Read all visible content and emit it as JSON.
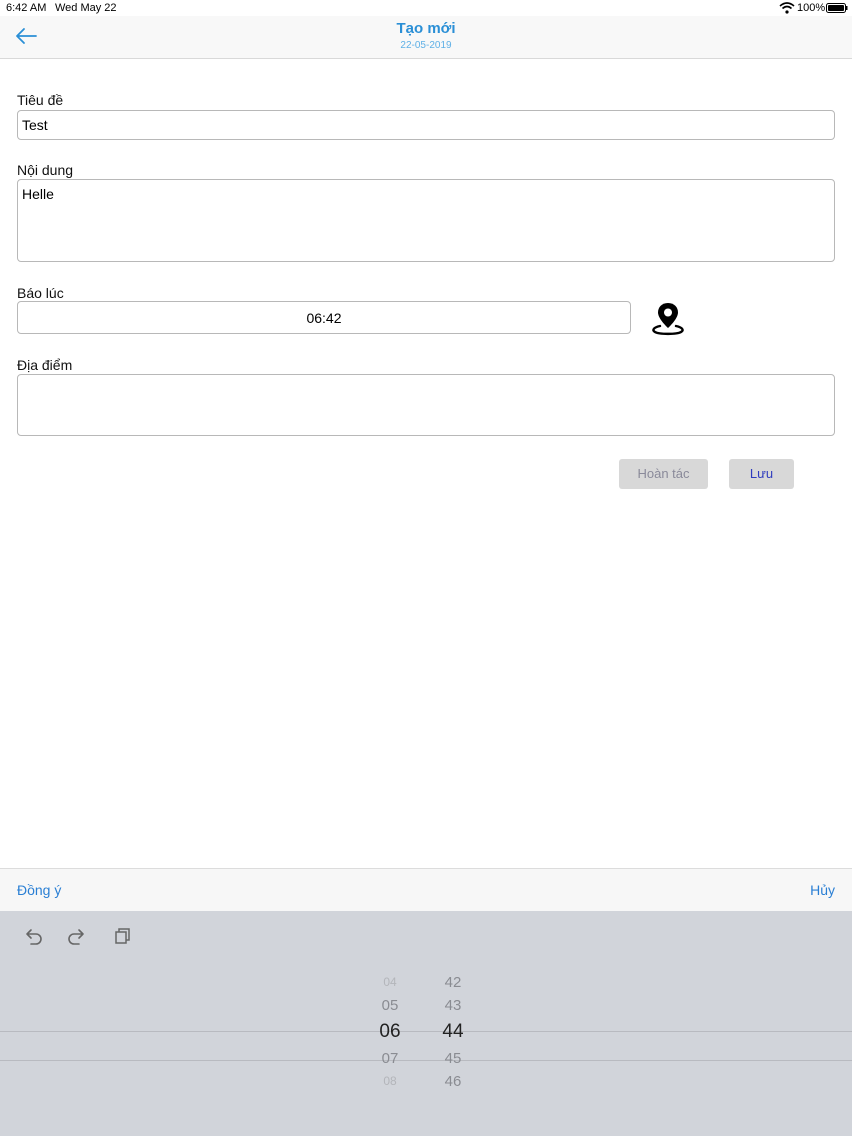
{
  "status_bar": {
    "time": "6:42 AM",
    "date": "Wed May 22",
    "battery": "100%"
  },
  "nav": {
    "title": "Tạo mới",
    "subtitle": "22-05-2019"
  },
  "form": {
    "title_label": "Tiêu đề",
    "title_value": "Test",
    "content_label": "Nội dung",
    "content_value": "Helle",
    "alarm_label": "Báo lúc",
    "alarm_value": "06:42",
    "location_label": "Địa điểm",
    "location_value": ""
  },
  "buttons": {
    "undo": "Hoàn tác",
    "save": "Lưu"
  },
  "toolbar": {
    "agree": "Đồng ý",
    "cancel": "Hủy"
  },
  "picker": {
    "hours": [
      "04",
      "05",
      "06",
      "07",
      "08"
    ],
    "minutes": [
      "42",
      "43",
      "44",
      "45",
      "46"
    ],
    "selected_hour": "06",
    "selected_minute": "44"
  },
  "icons": {
    "back": "back-arrow-icon",
    "location": "location-pin-icon",
    "undo": "undo-icon",
    "redo": "redo-icon",
    "paste": "paste-icon"
  },
  "colors": {
    "accent": "#2a8fd6",
    "link": "#2a7fd4"
  }
}
